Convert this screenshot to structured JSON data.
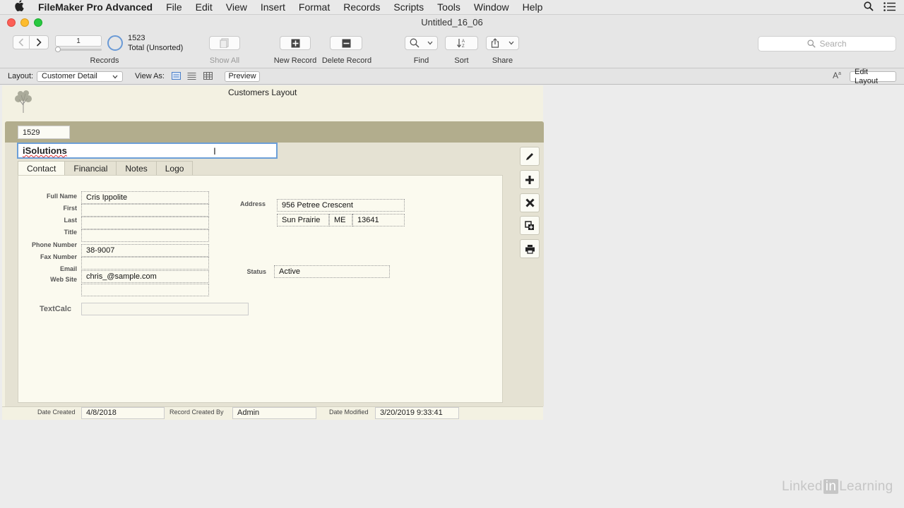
{
  "menubar": {
    "app_name": "FileMaker Pro Advanced",
    "items": [
      "File",
      "Edit",
      "View",
      "Insert",
      "Format",
      "Records",
      "Scripts",
      "Tools",
      "Window",
      "Help"
    ]
  },
  "window": {
    "title": "Untitled_16_06"
  },
  "toolbar": {
    "record_number": "1",
    "found_count": "1523",
    "total_status": "Total (Unsorted)",
    "records_label": "Records",
    "show_all_label": "Show All",
    "new_record_label": "New Record",
    "delete_record_label": "Delete Record",
    "find_label": "Find",
    "sort_label": "Sort",
    "share_label": "Share",
    "search_placeholder": "Search"
  },
  "layoutbar": {
    "layout_label": "Layout:",
    "layout_value": "Customer Detail",
    "view_as_label": "View As:",
    "preview_label": "Preview",
    "edit_layout_label": "Edit Layout"
  },
  "record": {
    "header_title": "Customers Layout",
    "id": "1529",
    "company": "iSolutions",
    "tabs": [
      "Contact",
      "Financial",
      "Notes",
      "Logo"
    ],
    "active_tab": "Contact",
    "labels": {
      "full_name": "Full Name",
      "first": "First",
      "last": "Last",
      "title": "Title",
      "phone": "Phone Number",
      "fax": "Fax Number",
      "email": "Email",
      "website": "Web Site",
      "address": "Address",
      "status": "Status",
      "textcalc": "TextCalc"
    },
    "values": {
      "full_name": "Cris Ippolite",
      "first": "",
      "last": "",
      "title": "",
      "phone": "38-9007",
      "fax": "",
      "email": "",
      "website": "chris_@sample.com",
      "address": "956 Petree Crescent",
      "city": "Sun Prairie",
      "state": "ME",
      "zip": "13641",
      "status": "Active",
      "textcalc": ""
    },
    "footer": {
      "date_created_label": "Date Created",
      "date_created": "4/8/2018",
      "created_by_label": "Record Created By",
      "created_by": "Admin",
      "date_modified_label": "Date Modified",
      "date_modified": "3/20/2019 9:33:41"
    }
  },
  "watermark": {
    "left": "Linked",
    "in": "in",
    "right": "Learning"
  }
}
